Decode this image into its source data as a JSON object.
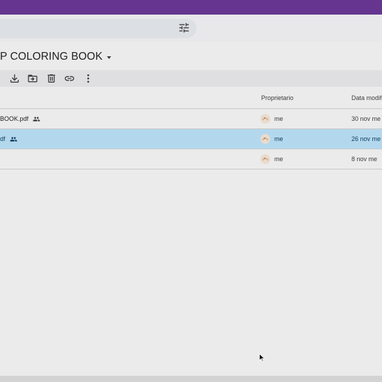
{
  "app": {
    "accent_color": "#65358f",
    "selected_row_color": "#b3d8ee"
  },
  "search": {
    "filter_icon": "tune-icon"
  },
  "folder": {
    "title": "P COLORING BOOK",
    "menu_icon": "caret-down-icon"
  },
  "toolbar": {
    "actions": [
      {
        "icon": "download-icon"
      },
      {
        "icon": "move-to-folder-icon"
      },
      {
        "icon": "trash-icon"
      },
      {
        "icon": "link-icon"
      },
      {
        "icon": "more-vert-icon"
      }
    ]
  },
  "table": {
    "columns": {
      "owner": "Proprietario",
      "modified": "Data modif"
    },
    "rows": [
      {
        "name": "BOOK.pdf",
        "shared": true,
        "owner": "me",
        "date": "30 nov me",
        "selected": false
      },
      {
        "name": "df",
        "shared": true,
        "owner": "me",
        "date": "26 nov me",
        "selected": true
      },
      {
        "name": "",
        "shared": false,
        "owner": "me",
        "date": "8 nov me",
        "selected": false
      }
    ]
  }
}
